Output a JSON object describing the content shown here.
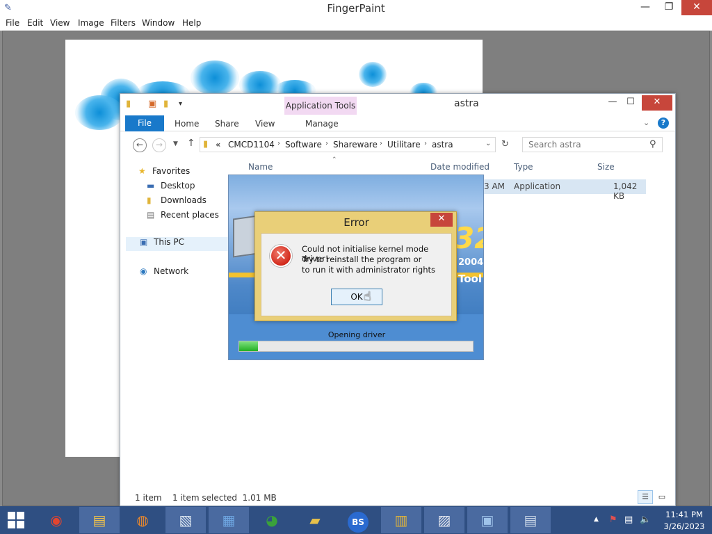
{
  "fingerpaint": {
    "title": "FingerPaint",
    "menu": [
      "File",
      "Edit",
      "View",
      "Image",
      "Filters",
      "Window",
      "Help"
    ]
  },
  "explorer": {
    "title": "astra",
    "context_tab": "Application Tools",
    "tabs": {
      "file": "File",
      "home": "Home",
      "share": "Share",
      "view": "View",
      "manage": "Manage"
    },
    "breadcrumb_prefix": "«",
    "breadcrumb": [
      "CMCD1104",
      "Software",
      "Shareware",
      "Utilitare",
      "astra"
    ],
    "search_placeholder": "Search astra",
    "nav": {
      "favorites": "Favorites",
      "desktop": "Desktop",
      "downloads": "Downloads",
      "recent": "Recent places",
      "this_pc": "This PC",
      "network": "Network"
    },
    "columns": {
      "name": "Name",
      "date": "Date modified",
      "type": "Type",
      "size": "Size"
    },
    "file": {
      "date_fragment": "3 AM",
      "type": "Application",
      "size": "1,042 KB"
    },
    "status": {
      "items": "1 item",
      "selected": "1 item selected  1.01 MB"
    }
  },
  "splash": {
    "logo_number": "32",
    "year": "2004",
    "tool": "Tool",
    "status": "Opening driver",
    "progress": 0.08
  },
  "error_dialog": {
    "title": "Error",
    "lines": [
      "Could not initialise kernel mode driver!",
      "Try to reinstall the program or",
      "to run it with administrator rights"
    ],
    "ok": "OK"
  },
  "taskbar": {
    "time": "11:41 PM",
    "date": "3/26/2023",
    "colors": {
      "background": "#2f4f82",
      "active": "#4a6aa0"
    }
  }
}
